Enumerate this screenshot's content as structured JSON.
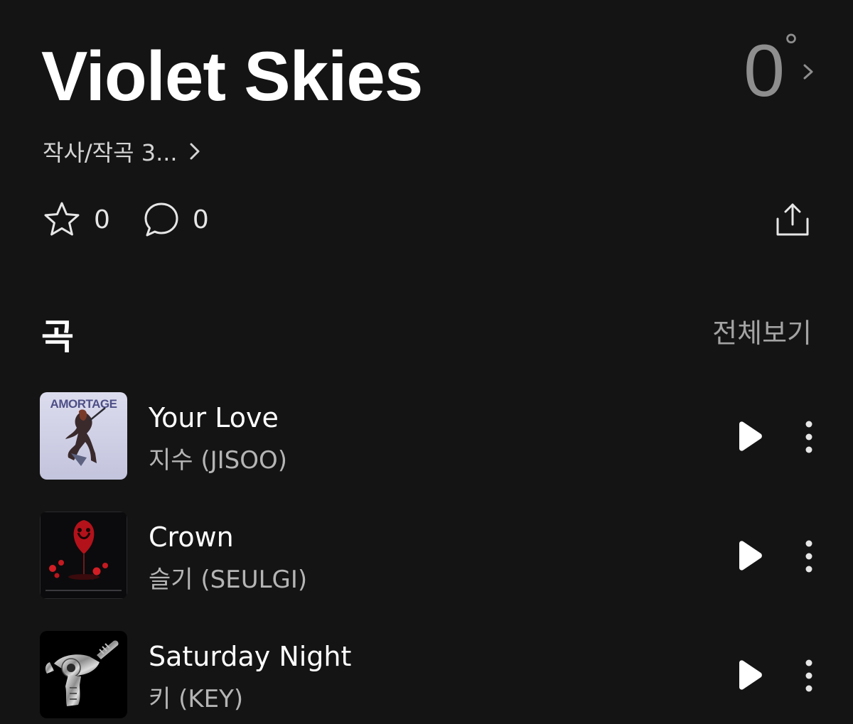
{
  "header": {
    "title": "Violet Skies",
    "rating_value": "0",
    "rating_suffix": "°",
    "credits": "작사/작곡 3..."
  },
  "actions": {
    "likes": "0",
    "comments": "0"
  },
  "icons": {
    "rating": "chevron-right-icon",
    "credits": "chevron-right-icon",
    "like": "star-outline-icon",
    "comment": "speech-bubble-icon",
    "share": "share-upload-icon",
    "play": "play-icon",
    "more": "more-vertical-icon"
  },
  "songs": {
    "title": "곡",
    "view_all": "전체보기",
    "items": [
      {
        "title": "Your Love",
        "artist": "지수 (JISOO)",
        "cover_text": "AMORTAGE"
      },
      {
        "title": "Crown",
        "artist": "슬기 (SEULGI)"
      },
      {
        "title": "Saturday Night",
        "artist": "키 (KEY)"
      }
    ]
  },
  "colors": {
    "background": "#141414",
    "primary_text": "#ffffff",
    "secondary_text": "#b5b5b5",
    "muted_text": "#8e8e8e"
  }
}
